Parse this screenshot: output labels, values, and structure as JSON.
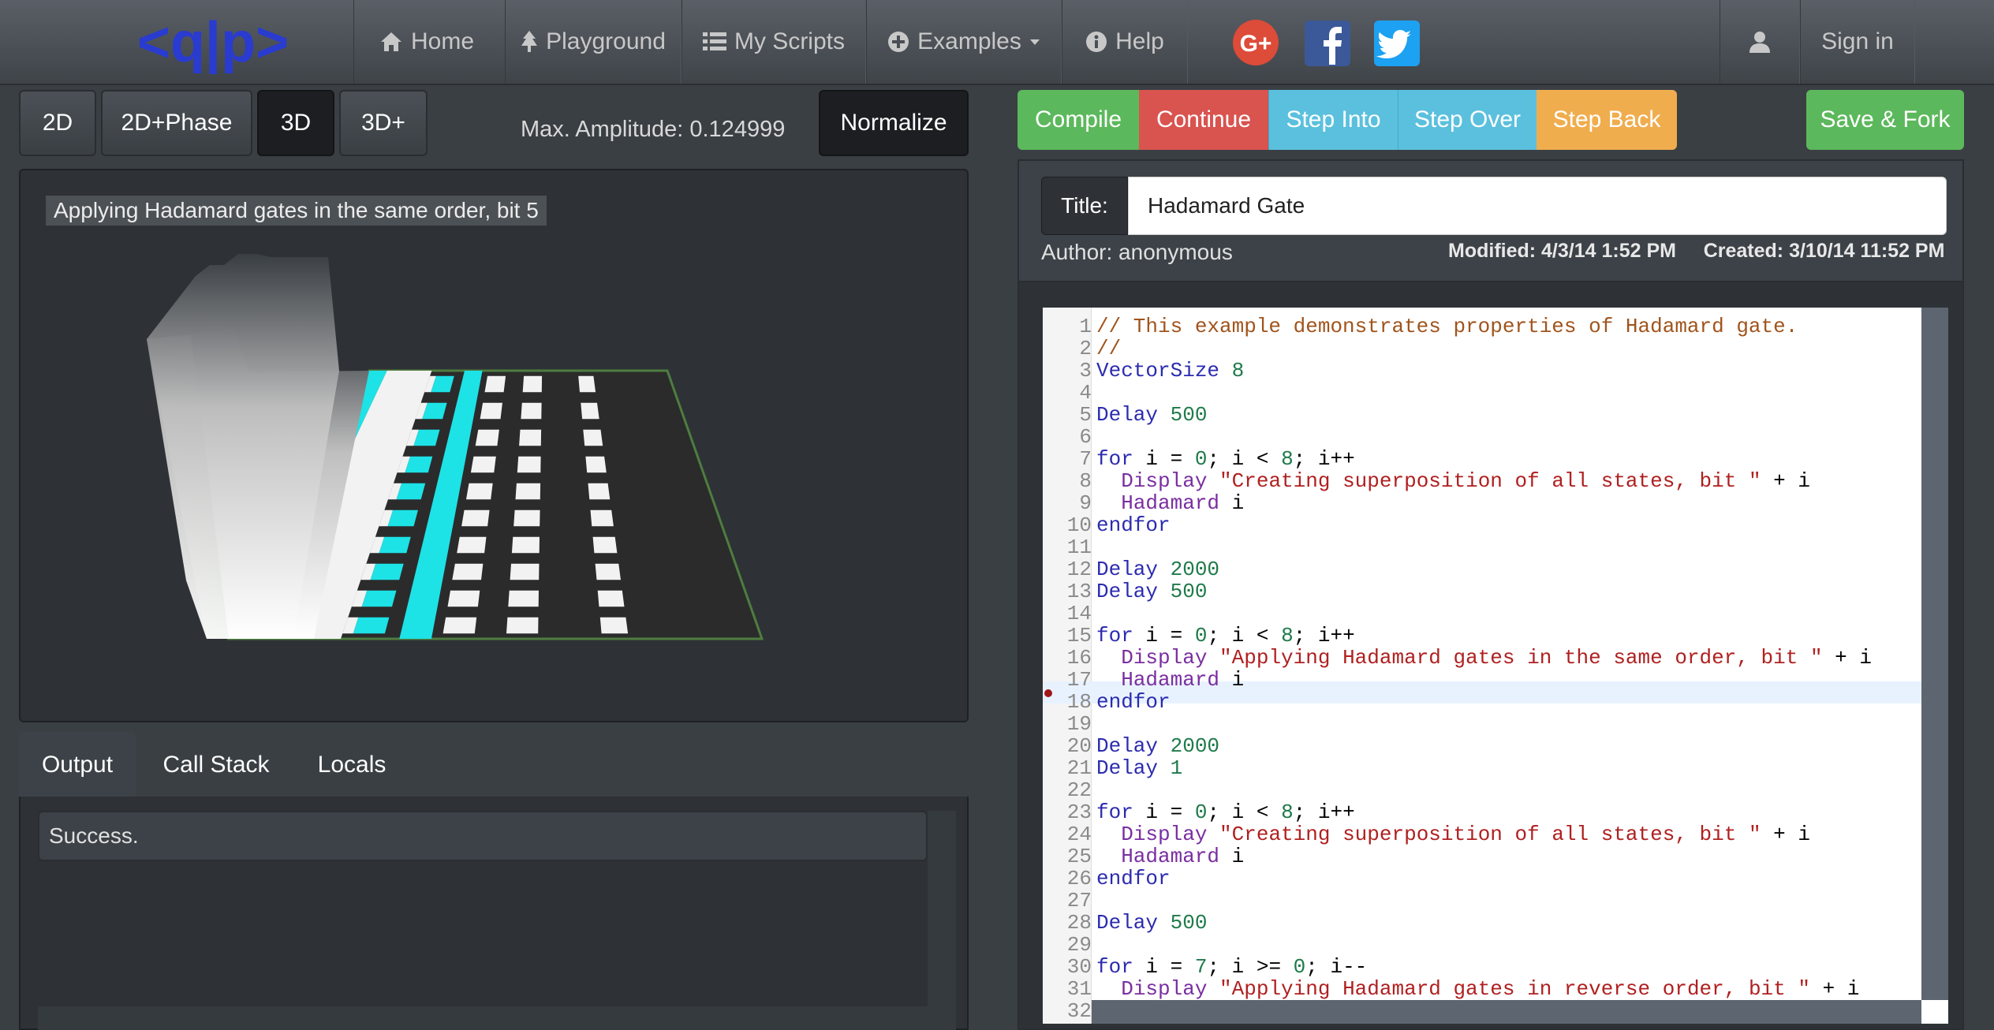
{
  "nav": {
    "logo_text": "<q|p>",
    "home": "Home",
    "playground": "Playground",
    "my_scripts": "My Scripts",
    "examples": "Examples",
    "help": "Help",
    "sign_in": "Sign in"
  },
  "view_modes": [
    "2D",
    "2D+Phase",
    "3D",
    "3D+"
  ],
  "max_amplitude": "Max. Amplitude: 0.124999",
  "normalize": "Normalize",
  "viz_label": "Applying Hadamard gates in the same order, bit 5",
  "debug": {
    "compile": "Compile",
    "continue": "Continue",
    "step_into": "Step Into",
    "step_over": "Step Over",
    "step_back": "Step Back",
    "save_fork": "Save & Fork"
  },
  "script": {
    "title_label": "Title:",
    "title_value": "Hadamard Gate",
    "author": "Author: anonymous",
    "modified": "Modified: 4/3/14 1:52 PM",
    "created": "Created: 3/10/14 11:52 PM"
  },
  "bottom_tabs": [
    "Output",
    "Call Stack",
    "Locals"
  ],
  "output_text": "Success.",
  "code": [
    "// This example demonstrates properties of Hadamard gate.",
    "//",
    "VectorSize 8",
    "",
    "Delay 500",
    "",
    "for i = 0; i < 8; i++",
    "  Display \"Creating superposition of all states, bit \" + i",
    "  Hadamard i",
    "endfor",
    "",
    "Delay 2000",
    "Delay 500",
    "",
    "for i = 0; i < 8; i++",
    "  Display \"Applying Hadamard gates in the same order, bit \" + i",
    "  Hadamard i",
    "endfor",
    "",
    "Delay 2000",
    "Delay 1",
    "",
    "for i = 0; i < 8; i++",
    "  Display \"Creating superposition of all states, bit \" + i",
    "  Hadamard i",
    "endfor",
    "",
    "Delay 500",
    "",
    "for i = 7; i >= 0; i--",
    "  Display \"Applying Hadamard gates in reverse order, bit \" + i",
    ""
  ],
  "breakpoint_line": 17,
  "colors": {
    "compile": "#5cb85c",
    "continue": "#d9534f",
    "step": "#5bc0de",
    "step_back": "#f0ad4e",
    "save_fork": "#5cb85c",
    "cyan_bar": "#1de2e6"
  }
}
